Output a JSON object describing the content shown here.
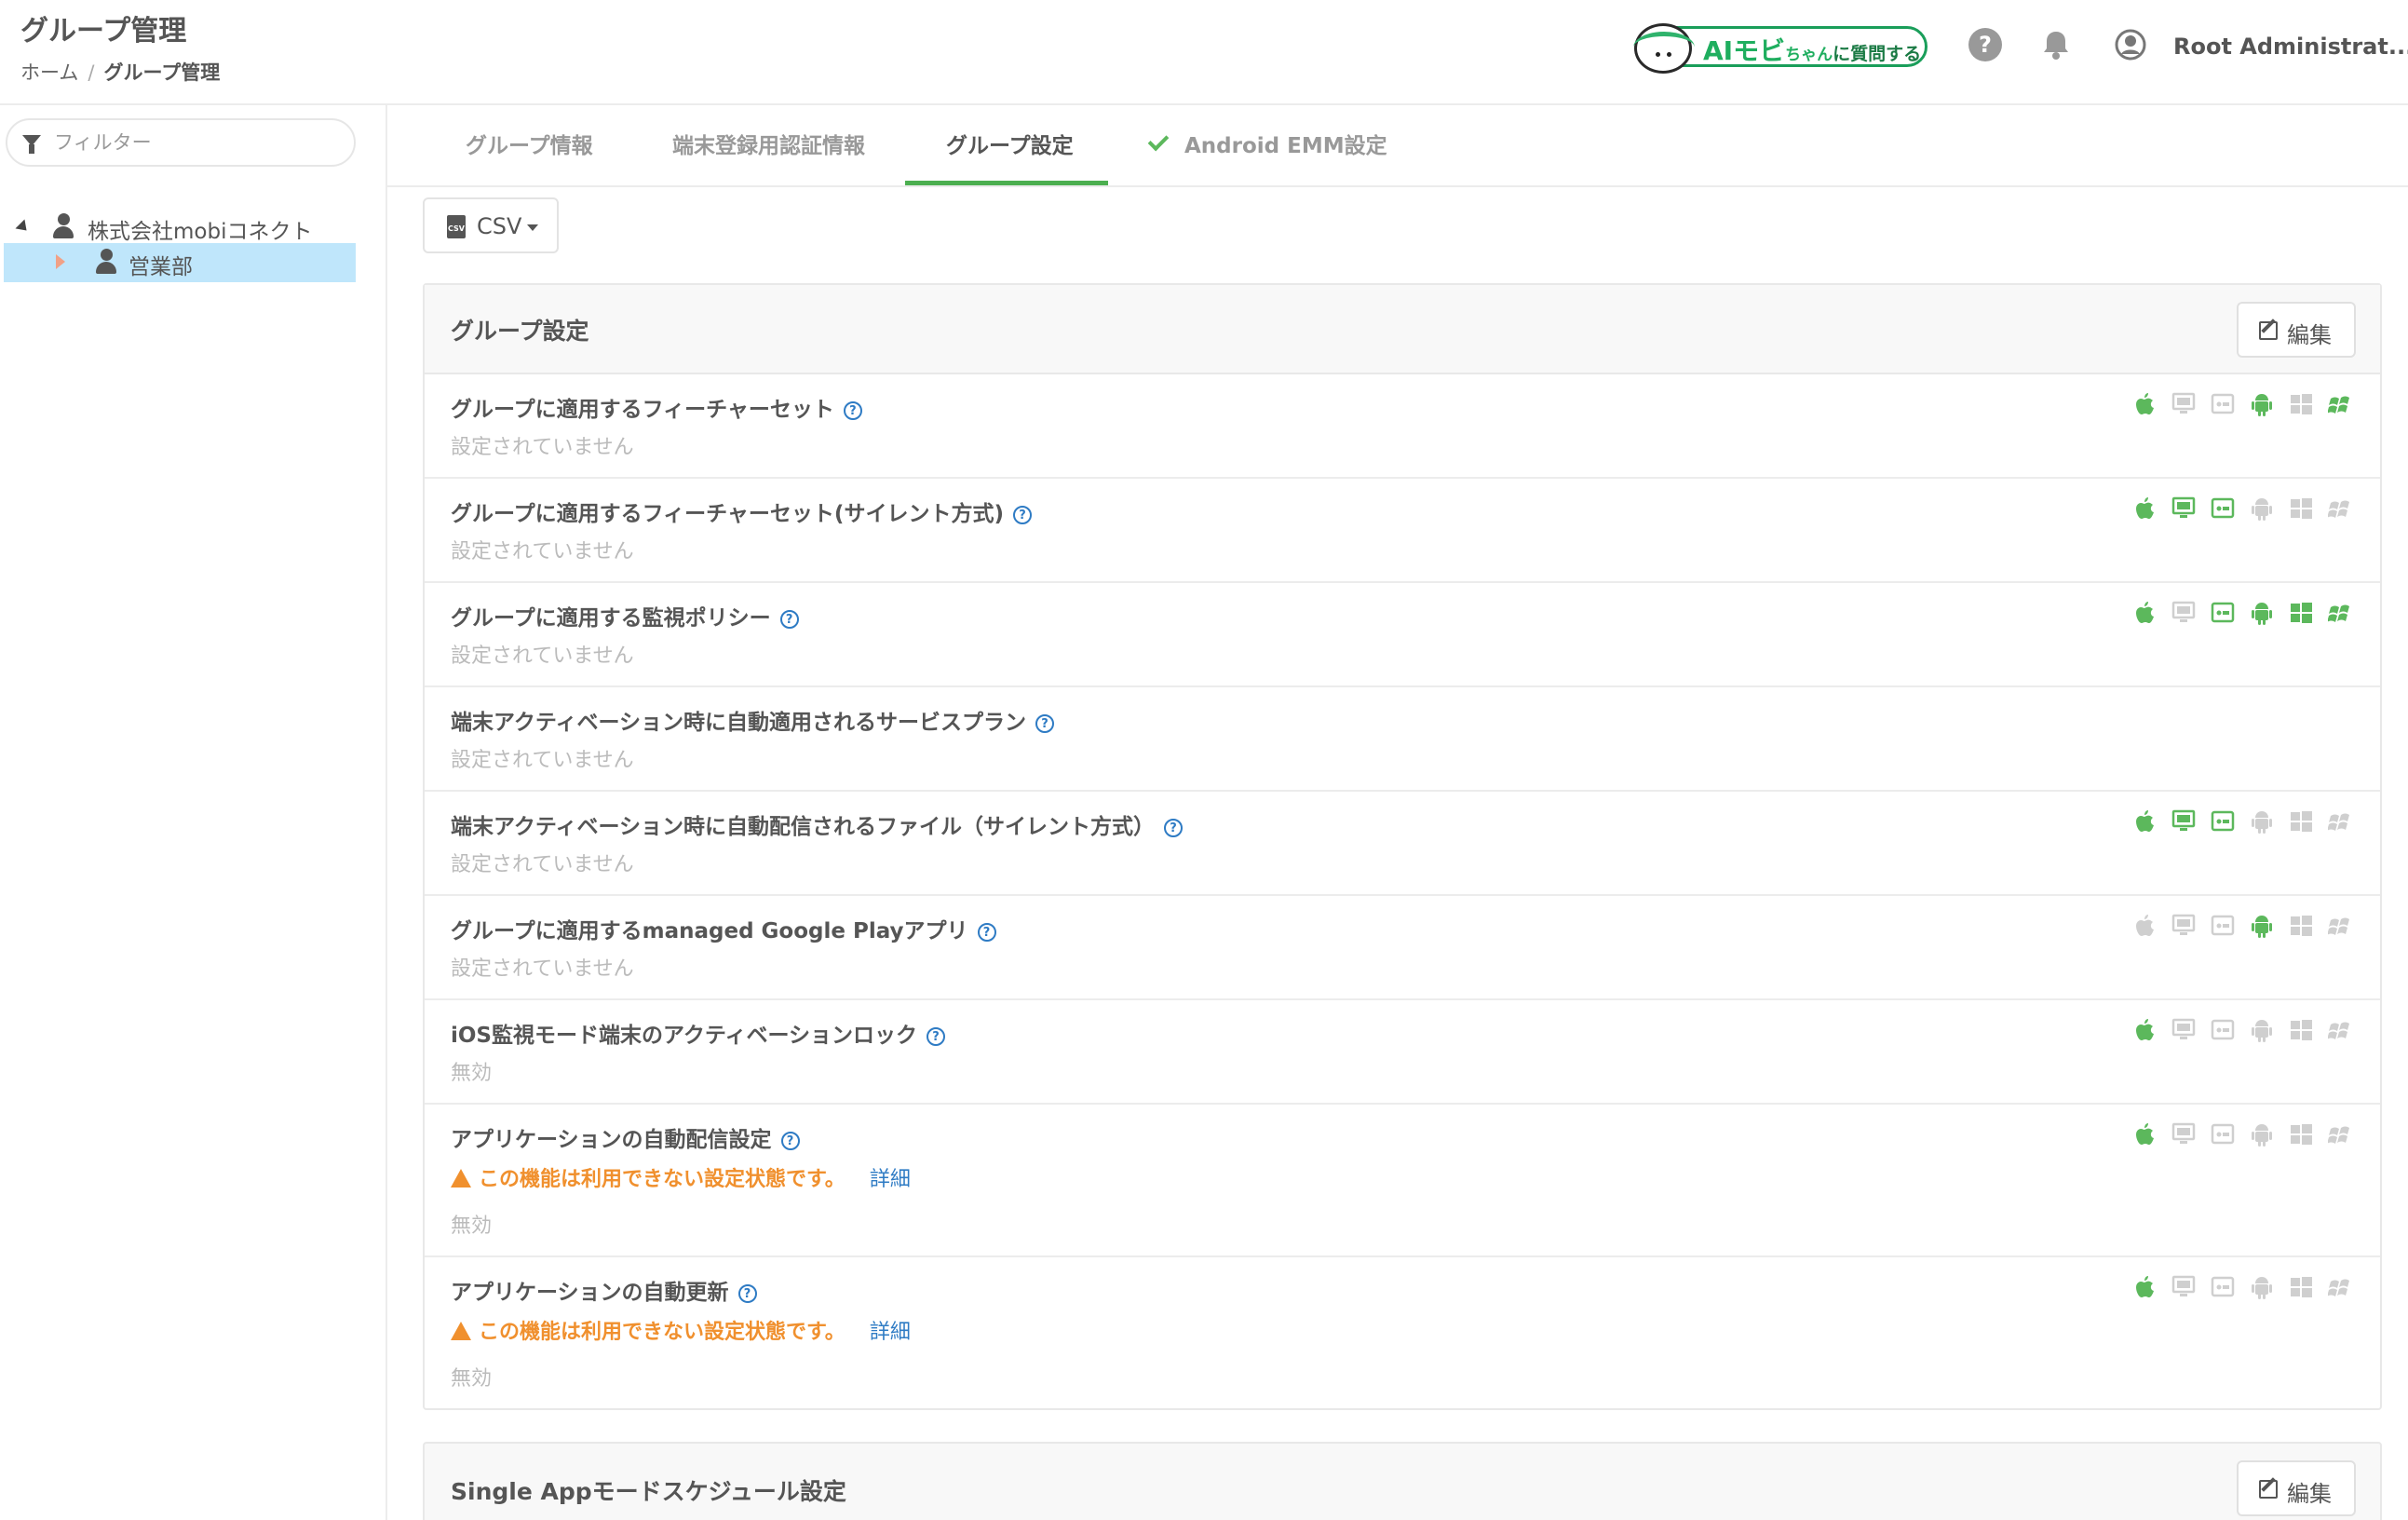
{
  "header": {
    "title": "グループ管理",
    "breadcrumb": {
      "home": "ホーム",
      "separator": "/",
      "current": "グループ管理"
    },
    "ai_button": {
      "prefix": "AIモビ",
      "mid": "ちゃん",
      "suffix": "に質問する"
    },
    "help_icon": "?",
    "user_name": "Root Administrat..."
  },
  "sidebar": {
    "filter_placeholder": "フィルター",
    "tree": [
      {
        "label": "株式会社mobiコネクト"
      },
      {
        "label": "営業部",
        "selected": true
      }
    ]
  },
  "tabs": [
    {
      "label": "グループ情報"
    },
    {
      "label": "端末登録用認証情報"
    },
    {
      "label": "グループ設定",
      "active": true
    },
    {
      "label": "Android EMM設定",
      "checked": true
    }
  ],
  "csv_button": {
    "label": "CSV",
    "icon_text": "CSV"
  },
  "panel": {
    "title": "グループ設定",
    "edit_label": "編集",
    "rows": [
      {
        "title": "グループに適用するフィーチャーセット",
        "value": "設定されていません",
        "platforms": [
          true,
          false,
          false,
          true,
          false,
          true
        ]
      },
      {
        "title": "グループに適用するフィーチャーセット(サイレント方式)",
        "value": "設定されていません",
        "platforms": [
          true,
          true,
          true,
          false,
          false,
          false
        ]
      },
      {
        "title": "グループに適用する監視ポリシー",
        "value": "設定されていません",
        "platforms": [
          true,
          false,
          true,
          true,
          true,
          true
        ]
      },
      {
        "title": "端末アクティベーション時に自動適用されるサービスプラン",
        "value": "設定されていません",
        "platforms": null
      },
      {
        "title": "端末アクティベーション時に自動配信されるファイル（サイレント方式）",
        "value": "設定されていません",
        "platforms": [
          true,
          true,
          true,
          false,
          false,
          false
        ]
      },
      {
        "title": "グループに適用するmanaged Google Playアプリ",
        "value": "設定されていません",
        "platforms": [
          false,
          false,
          false,
          true,
          false,
          false
        ]
      },
      {
        "title": "iOS監視モード端末のアクティベーションロック",
        "value": "無効",
        "platforms": [
          true,
          false,
          false,
          false,
          false,
          false
        ]
      },
      {
        "title": "アプリケーションの自動配信設定",
        "warning": "この機能は利用できない設定状態です。",
        "warning_link": "詳細",
        "value": "無効",
        "platforms": [
          true,
          false,
          false,
          false,
          false,
          false
        ]
      },
      {
        "title": "アプリケーションの自動更新",
        "warning": "この機能は利用できない設定状態です。",
        "warning_link": "詳細",
        "value": "無効",
        "platforms": [
          true,
          false,
          false,
          false,
          false,
          false
        ]
      }
    ]
  },
  "panel2": {
    "title": "Single Appモードスケジュール設定",
    "edit_label": "編集"
  },
  "colors": {
    "accent_green": "#5cb85c",
    "tab_underline": "#4caf50",
    "warning": "#f0902e",
    "link": "#2e7bc4",
    "selected_bg": "#bfe6fb",
    "icon_inactive": "#cfcfcf"
  },
  "platform_icons": [
    "apple-icon",
    "macos-icon",
    "appletv-icon",
    "android-icon",
    "windows-icon",
    "windows-legacy-icon"
  ]
}
